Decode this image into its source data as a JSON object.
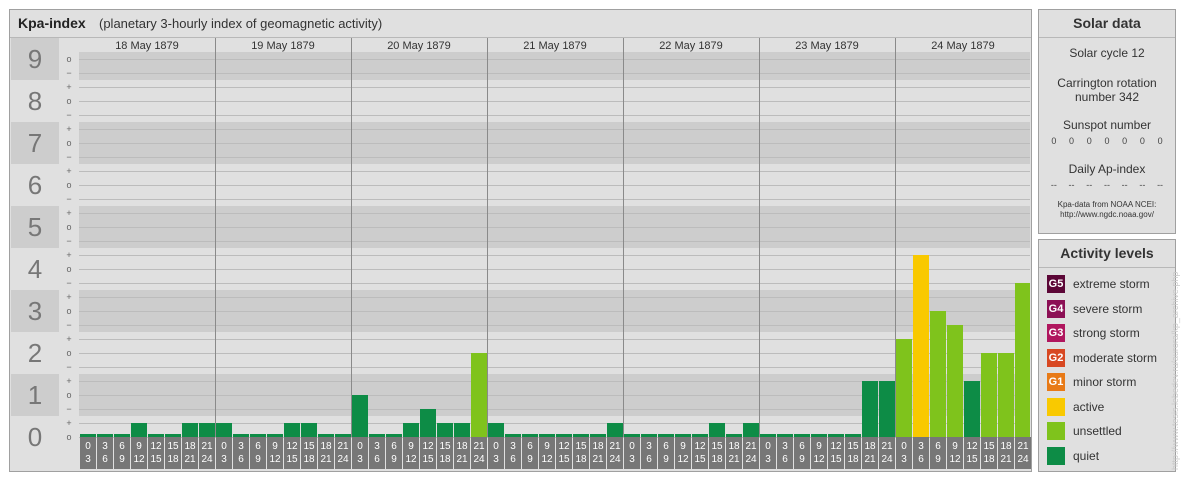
{
  "header": {
    "title": "Kpa-index",
    "subtitle": "(planetary 3-hourly index of geomagnetic activity)"
  },
  "colors": {
    "quiet": "#0d8c46",
    "unsettled": "#7fc31c",
    "active": "#f9c900",
    "minor_storm": "#e87a17",
    "moderate_storm": "#d84822",
    "strong_storm": "#b0165e",
    "severe_storm": "#8c1055",
    "extreme_storm": "#5c0737"
  },
  "y_axis": {
    "levels": [
      "0",
      "1",
      "2",
      "3",
      "4",
      "5",
      "6",
      "7",
      "8",
      "9"
    ],
    "sub_marks": [
      "+",
      "o",
      "−"
    ]
  },
  "chart_data": {
    "type": "bar",
    "ylim": [
      0,
      9
    ],
    "dates": [
      "18 May 1879",
      "19 May 1879",
      "20 May 1879",
      "21 May 1879",
      "22 May 1879",
      "23 May 1879",
      "24 May 1879"
    ],
    "interval_labels": [
      [
        "0",
        "3"
      ],
      [
        "3",
        "6"
      ],
      [
        "6",
        "9"
      ],
      [
        "9",
        "12"
      ],
      [
        "12",
        "15"
      ],
      [
        "15",
        "18"
      ],
      [
        "18",
        "21"
      ],
      [
        "21",
        "24"
      ]
    ],
    "values": [
      [
        0,
        0,
        0,
        0.333,
        0,
        0,
        0.333,
        0.333
      ],
      [
        0.333,
        0,
        0,
        0,
        0.333,
        0.333,
        0,
        0
      ],
      [
        1,
        0,
        0,
        0.333,
        0.667,
        0.333,
        0.333,
        2
      ],
      [
        0.333,
        0,
        0,
        0,
        0,
        0,
        0,
        0.333
      ],
      [
        0,
        0,
        0,
        0,
        0,
        0.333,
        0,
        0.333
      ],
      [
        0,
        0,
        0,
        0,
        0,
        0,
        1.333,
        1.333
      ],
      [
        2.333,
        4.333,
        3,
        2.667,
        1.333,
        2,
        2,
        3.667
      ]
    ]
  },
  "solar_data": {
    "title": "Solar data",
    "solar_cycle": "Solar cycle 12",
    "carrington_line1": "Carrington rotation",
    "carrington_line2": "number 342",
    "sunspot_label": "Sunspot number",
    "sunspot_values": [
      "0",
      "0",
      "0",
      "0",
      "0",
      "0",
      "0"
    ],
    "ap_label": "Daily Ap-index",
    "ap_values": [
      "--",
      "--",
      "--",
      "--",
      "--",
      "--",
      "--"
    ],
    "note_line1": "Kpa-data from NOAA NCEI:",
    "note_line2": "http://www.ngdc.noaa.gov/"
  },
  "activity_levels": {
    "title": "Activity levels",
    "items": [
      {
        "code": "G5",
        "label": "extreme storm",
        "color": "#5c0737"
      },
      {
        "code": "G4",
        "label": "severe storm",
        "color": "#8c1055"
      },
      {
        "code": "G3",
        "label": "strong storm",
        "color": "#b0165e"
      },
      {
        "code": "G2",
        "label": "moderate storm",
        "color": "#d84822"
      },
      {
        "code": "G1",
        "label": "minor storm",
        "color": "#e87a17"
      },
      {
        "code": "",
        "label": "active",
        "color": "#f9c900"
      },
      {
        "code": "",
        "label": "unsettled",
        "color": "#7fc31c"
      },
      {
        "code": "",
        "label": "quiet",
        "color": "#0d8c46"
      }
    ]
  },
  "watermark": "http://www.tesis.lebedev.ru/aurora/kp_archive.php"
}
